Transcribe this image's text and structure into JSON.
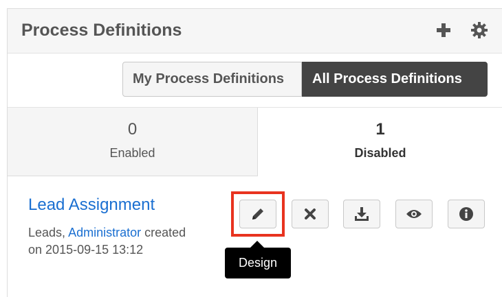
{
  "header": {
    "title": "Process Definitions",
    "add_icon": "plus-icon",
    "settings_icon": "gear-icon"
  },
  "filters": {
    "my_label": "My Process Definitions",
    "all_label": "All Process Definitions",
    "selected": "All Process Definitions"
  },
  "tabs": [
    {
      "count": "0",
      "label": "Enabled"
    },
    {
      "count": "1",
      "label": "Disabled"
    }
  ],
  "record": {
    "name": "Lead Assignment",
    "module": "Leads,",
    "user": "Administrator",
    "created_word": "created",
    "date_prefix": "on",
    "date": "2015-09-15 13:12"
  },
  "actions": {
    "design_icon": "pencil-icon",
    "delete_icon": "close-icon",
    "export_icon": "download-icon",
    "view_icon": "eye-icon",
    "info_icon": "info-icon"
  },
  "tooltip": {
    "text": "Design"
  },
  "colors": {
    "link": "#1a6fd1",
    "highlight": "#e8331f",
    "active_filter": "#444444"
  }
}
